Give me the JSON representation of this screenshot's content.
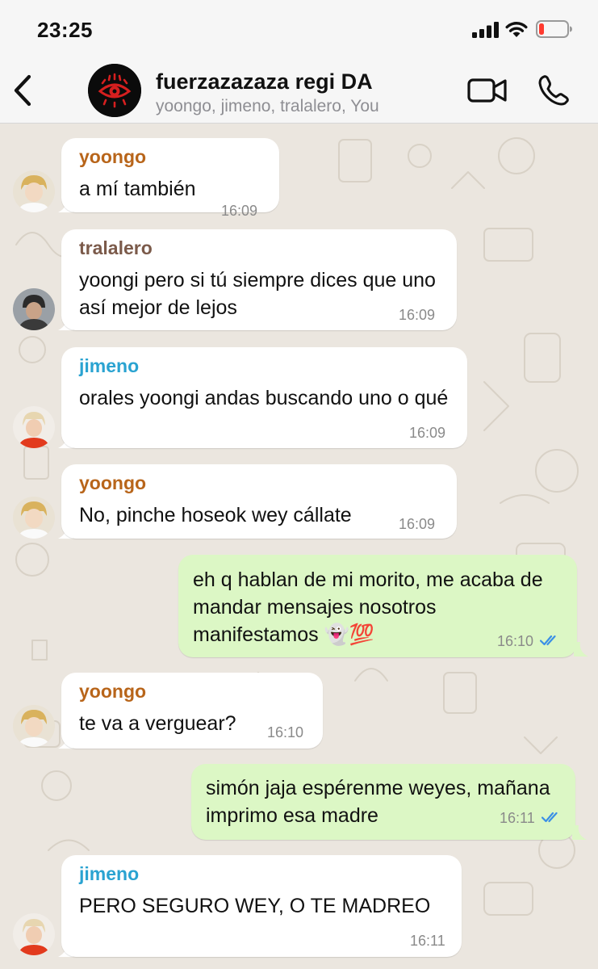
{
  "status_bar": {
    "time": "23:25"
  },
  "header": {
    "title": "fuerzazazaza regi DA",
    "members": "yoongo, jimeno, tralalero, You"
  },
  "colors": {
    "yoongo": "#b8651a",
    "tralalero": "#7b5a4a",
    "jimeno": "#2aa3d1",
    "outgoing_bubble": "#dcf7c5",
    "read_ticks": "#3b8fe6"
  },
  "messages": [
    {
      "sender": "yoongo",
      "text": "a mí también",
      "time": "16:09"
    },
    {
      "sender": "tralalero",
      "text": "yoongi pero si tú siempre dices que uno así mejor de lejos",
      "time": "16:09"
    },
    {
      "sender": "jimeno",
      "text": "orales yoongi andas buscando uno o qué",
      "time": "16:09"
    },
    {
      "sender": "yoongo",
      "text": "No, pinche hoseok wey cállate",
      "time": "16:09"
    },
    {
      "sender": "You",
      "text": "eh q hablan de mi morito, me acaba de mandar mensajes nosotros manifestamos 👻💯",
      "time": "16:10",
      "status": "read"
    },
    {
      "sender": "yoongo",
      "text": "te va a verguear?",
      "time": "16:10"
    },
    {
      "sender": "You",
      "text": "simón jaja espérenme weyes, mañana imprimo esa madre",
      "time": "16:11",
      "status": "read"
    },
    {
      "sender": "jimeno",
      "text": "PERO SEGURO WEY, O TE MADREO",
      "time": "16:11"
    }
  ]
}
